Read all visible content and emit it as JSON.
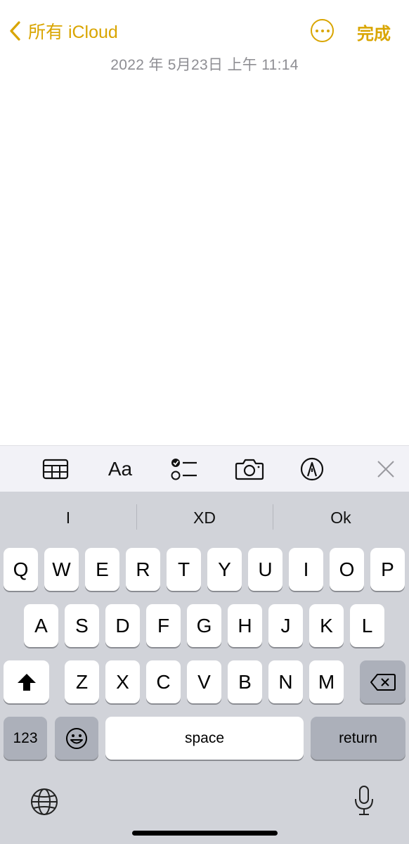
{
  "nav": {
    "back_label": "所有 iCloud",
    "done_label": "完成"
  },
  "note": {
    "date": "2022 年 5月23日 上午 11:14",
    "content": ""
  },
  "toolbar": {
    "format_label": "Aa",
    "icons": [
      "table-icon",
      "format-icon",
      "checklist-icon",
      "camera-icon",
      "markup-icon",
      "close-icon"
    ]
  },
  "keyboard": {
    "suggestions": [
      "I",
      "XD",
      "Ok"
    ],
    "row1": [
      "Q",
      "W",
      "E",
      "R",
      "T",
      "Y",
      "U",
      "I",
      "O",
      "P"
    ],
    "row2": [
      "A",
      "S",
      "D",
      "F",
      "G",
      "H",
      "J",
      "K",
      "L"
    ],
    "row3": [
      "Z",
      "X",
      "C",
      "V",
      "B",
      "N",
      "M"
    ],
    "numbers_label": "123",
    "space_label": "space",
    "return_label": "return"
  },
  "colors": {
    "accent": "#d9a500",
    "keyboard_bg": "#d1d3d9",
    "toolbar_bg": "#f2f2f7"
  }
}
